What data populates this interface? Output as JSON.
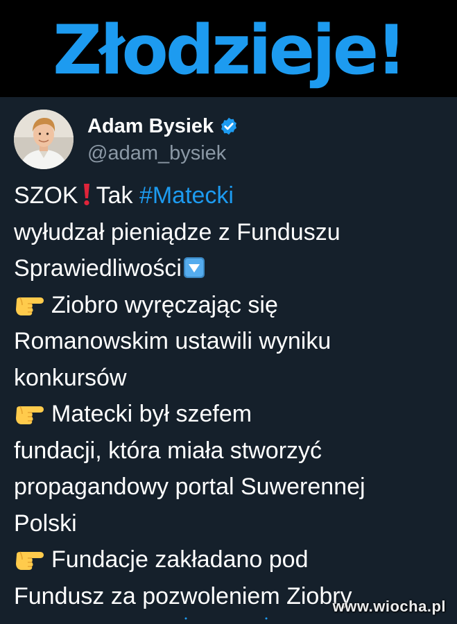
{
  "headline": {
    "text": "Złodzieje!",
    "color": "#1d9bf0"
  },
  "tweet": {
    "author": {
      "display_name": "Adam Bysiek",
      "handle": "@adam_bysiek",
      "verified": true,
      "avatar": "avatar-photo"
    },
    "lines": [
      {
        "type": "hashtag-line",
        "lead": "SZOK",
        "icon": "red-exclamation-icon",
        "mid": "Tak ",
        "hashtag": "#Matecki"
      },
      {
        "type": "text",
        "text": "wyłudzał pieniądze z Funduszu"
      },
      {
        "type": "text-icon",
        "text": "Sprawiedliwości",
        "icon": "down-arrow-button-icon"
      },
      {
        "type": "bullet",
        "icon": "pointing-hand-icon",
        "text": "Ziobro wyręczając się"
      },
      {
        "type": "text",
        "text": "Romanowskim ustawili wyniku"
      },
      {
        "type": "text",
        "text": "konkursów"
      },
      {
        "type": "bullet",
        "icon": "pointing-hand-icon",
        "text": "Matecki był szefem"
      },
      {
        "type": "text",
        "text": "fundacji, która miała stworzyć"
      },
      {
        "type": "text",
        "text": "propagandowy portal Suwerennej"
      },
      {
        "type": "text",
        "text": "Polski"
      },
      {
        "type": "bullet",
        "icon": "pointing-hand-icon",
        "text": "Fundacje zakładano pod"
      },
      {
        "type": "text",
        "text": "Fundusz za pozwoleniem Ziobry"
      }
    ]
  },
  "watermark": "www.wiocha.pl",
  "colors": {
    "background": "#15202b",
    "banner": "#000000",
    "text": "#ffffff",
    "handle": "#8b98a5",
    "link": "#1d9bf0"
  }
}
